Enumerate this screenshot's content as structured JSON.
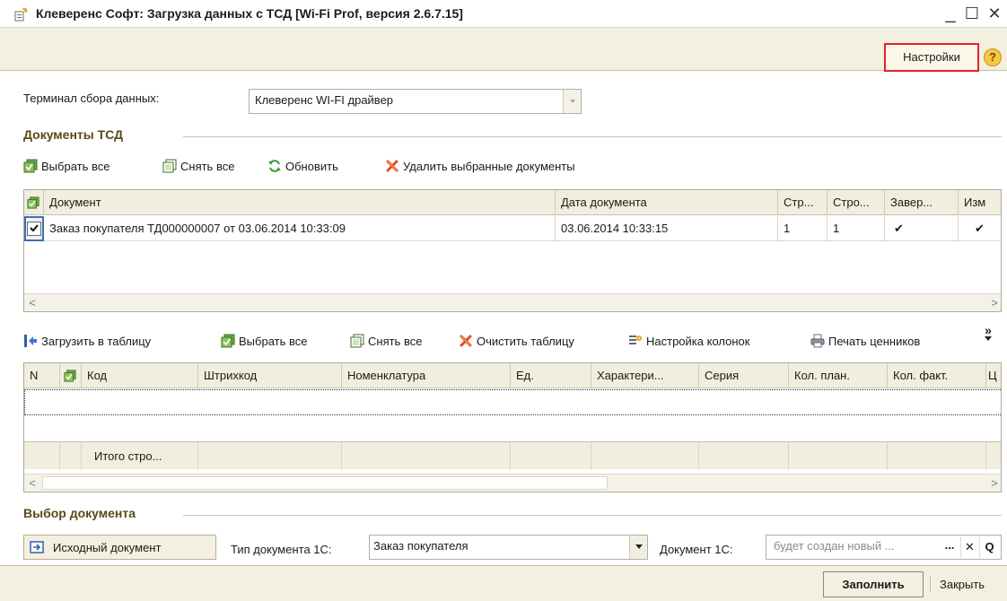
{
  "window": {
    "title": "Клеверенс Софт: Загрузка данных с ТСД [Wi-Fi Prof, версия 2.6.7.15]",
    "minimize": "_",
    "maximize": "☐",
    "close": "✕"
  },
  "topbar": {
    "settings_label": "Настройки",
    "help": "?"
  },
  "terminal": {
    "label": "Терминал сбора данных:",
    "value": "Клеверенс WI-FI драйвер"
  },
  "documents": {
    "section_title": "Документы ТСД",
    "toolbar": {
      "select_all": "Выбрать все",
      "deselect_all": "Снять все",
      "refresh": "Обновить",
      "delete_selected": "Удалить выбранные документы"
    },
    "columns": [
      "Документ",
      "Дата документа",
      "Стр...",
      "Стро...",
      "Завер...",
      "Изм"
    ],
    "rows": [
      {
        "checked": true,
        "document": "Заказ покупателя ТД000000007 от 03.06.2014 10:33:09",
        "date": "03.06.2014 10:33:15",
        "c1": "1",
        "c2": "1",
        "done": "✔",
        "changed": "✔"
      }
    ]
  },
  "lines": {
    "toolbar": {
      "load": "Загрузить в таблицу",
      "select_all": "Выбрать все",
      "deselect_all": "Снять все",
      "clear": "Очистить таблицу",
      "columns_setup": "Настройка колонок",
      "print_tags": "Печать ценников",
      "more": "»"
    },
    "columns": [
      "N",
      "Код",
      "Штрихкод",
      "Номенклатура",
      "Ед.",
      "Характери...",
      "Серия",
      "Кол. план.",
      "Кол. факт.",
      "Ц"
    ],
    "footer_total": "Итого стро..."
  },
  "selection": {
    "section_title": "Выбор документа",
    "source_button": "Исходный документ",
    "doc_type_label": "Тип документа 1С:",
    "doc_type_value": "Заказ покупателя",
    "doc_label": "Документ 1С:",
    "doc_placeholder": "будет создан новый ...",
    "dots": "...",
    "clear": "✕",
    "search": "Q"
  },
  "bottom": {
    "fill_button": "Заполнить",
    "close_button": "Закрыть"
  },
  "colors": {
    "accent": "#e0242a",
    "section_text": "#5a4a16",
    "panel": "#f3f0df"
  }
}
